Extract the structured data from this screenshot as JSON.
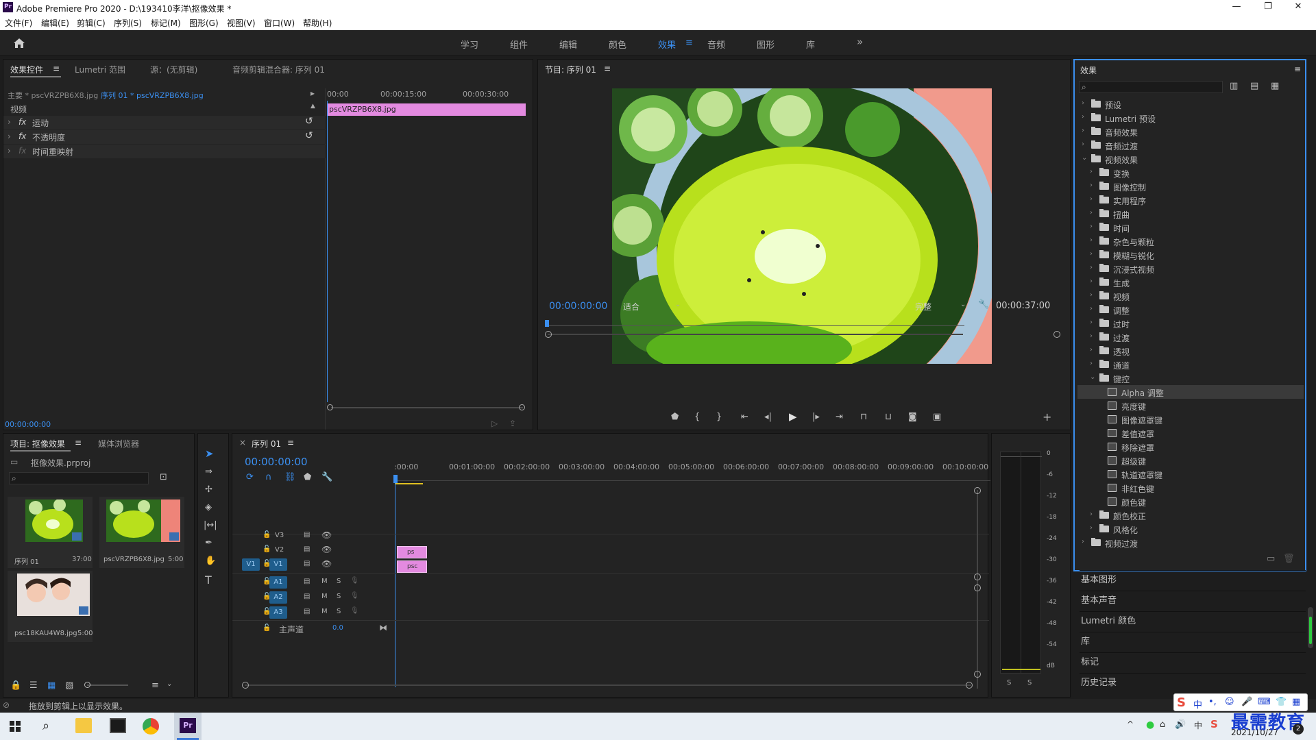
{
  "titlebar": {
    "logo": "Pr",
    "title": "Adobe Premiere Pro 2020 - D:\\193410李洋\\抠像效果 *",
    "min": "—",
    "max": "❐",
    "close": "✕"
  },
  "menu": [
    "文件(F)",
    "编辑(E)",
    "剪辑(C)",
    "序列(S)",
    "标记(M)",
    "图形(G)",
    "视图(V)",
    "窗口(W)",
    "帮助(H)"
  ],
  "workspaces": {
    "items": [
      "学习",
      "组件",
      "编辑",
      "颜色",
      "效果",
      "音频",
      "图形",
      "库"
    ],
    "active": "效果",
    "more": "»"
  },
  "effect_controls": {
    "tabs": [
      "效果控件",
      "Lumetri 范围",
      "源：(无剪辑)",
      "音频剪辑混合器: 序列 01"
    ],
    "master": "主要 * pscVRZPB6X8.jpg",
    "sequence": "序列 01 * pscVRZPB6X8.jpg",
    "section": "视频",
    "rows": [
      "运动",
      "不透明度",
      "时间重映射"
    ],
    "ruler": [
      "00:00",
      "00:00:15:00",
      "00:00:30:00"
    ],
    "clip": "pscVRZPB6X8.jpg",
    "timecode": "00:00:00:00"
  },
  "program": {
    "title": "节目: 序列 01",
    "timecode": "00:00:00:00",
    "fit": "适合",
    "quality": "完整",
    "duration": "00:00:37:00"
  },
  "effects_panel": {
    "title": "效果",
    "search_placeholder": "",
    "tree": [
      {
        "label": "预设",
        "level": 0,
        "type": "folder",
        "open": false
      },
      {
        "label": "Lumetri 预设",
        "level": 0,
        "type": "folder",
        "open": false
      },
      {
        "label": "音频效果",
        "level": 0,
        "type": "folder",
        "open": false
      },
      {
        "label": "音频过渡",
        "level": 0,
        "type": "folder",
        "open": false
      },
      {
        "label": "视频效果",
        "level": 0,
        "type": "folder",
        "open": true
      },
      {
        "label": "变换",
        "level": 1,
        "type": "folder",
        "open": false
      },
      {
        "label": "图像控制",
        "level": 1,
        "type": "folder",
        "open": false
      },
      {
        "label": "实用程序",
        "level": 1,
        "type": "folder",
        "open": false
      },
      {
        "label": "扭曲",
        "level": 1,
        "type": "folder",
        "open": false
      },
      {
        "label": "时间",
        "level": 1,
        "type": "folder",
        "open": false
      },
      {
        "label": "杂色与颗粒",
        "level": 1,
        "type": "folder",
        "open": false
      },
      {
        "label": "模糊与锐化",
        "level": 1,
        "type": "folder",
        "open": false
      },
      {
        "label": "沉浸式视频",
        "level": 1,
        "type": "folder",
        "open": false
      },
      {
        "label": "生成",
        "level": 1,
        "type": "folder",
        "open": false
      },
      {
        "label": "视频",
        "level": 1,
        "type": "folder",
        "open": false
      },
      {
        "label": "调整",
        "level": 1,
        "type": "folder",
        "open": false
      },
      {
        "label": "过时",
        "level": 1,
        "type": "folder",
        "open": false
      },
      {
        "label": "过渡",
        "level": 1,
        "type": "folder",
        "open": false
      },
      {
        "label": "透视",
        "level": 1,
        "type": "folder",
        "open": false
      },
      {
        "label": "通道",
        "level": 1,
        "type": "folder",
        "open": false
      },
      {
        "label": "键控",
        "level": 1,
        "type": "folder",
        "open": true
      },
      {
        "label": "Alpha 调整",
        "level": 2,
        "type": "preset",
        "selected": true
      },
      {
        "label": "亮度键",
        "level": 2,
        "type": "preset"
      },
      {
        "label": "图像遮罩键",
        "level": 2,
        "type": "preset"
      },
      {
        "label": "差值遮罩",
        "level": 2,
        "type": "preset"
      },
      {
        "label": "移除遮罩",
        "level": 2,
        "type": "preset"
      },
      {
        "label": "超级键",
        "level": 2,
        "type": "preset"
      },
      {
        "label": "轨道遮罩键",
        "level": 2,
        "type": "preset"
      },
      {
        "label": "非红色键",
        "level": 2,
        "type": "preset"
      },
      {
        "label": "颜色键",
        "level": 2,
        "type": "preset"
      },
      {
        "label": "颜色校正",
        "level": 1,
        "type": "folder",
        "open": false
      },
      {
        "label": "风格化",
        "level": 1,
        "type": "folder",
        "open": false
      },
      {
        "label": "视频过渡",
        "level": 0,
        "type": "folder",
        "open": false
      }
    ]
  },
  "side_panels": [
    "基本图形",
    "基本声音",
    "Lumetri 颜色",
    "库",
    "标记",
    "历史记录"
  ],
  "project": {
    "tabs": [
      "项目: 抠像效果",
      "媒体浏览器"
    ],
    "file": "抠像效果.prproj",
    "items": [
      {
        "name": "序列 01",
        "duration": "37:00"
      },
      {
        "name": "pscVRZPB6X8.jpg",
        "duration": "5:00"
      },
      {
        "name": "psc18KAU4W8.jpg",
        "duration": "5:00"
      }
    ]
  },
  "timeline": {
    "tab": "序列 01",
    "timecode": "00:00:00:00",
    "ruler": [
      ":00:00",
      "00:01:00:00",
      "00:02:00:00",
      "00:03:00:00",
      "00:04:00:00",
      "00:05:00:00",
      "00:06:00:00",
      "00:07:00:00",
      "00:08:00:00",
      "00:09:00:00",
      "00:10:00:00"
    ],
    "video_tracks": [
      "V3",
      "V2",
      "V1"
    ],
    "audio_tracks": [
      "A1",
      "A2",
      "A3"
    ],
    "source_patch": "V1",
    "master": "主声道",
    "master_value": "0.0",
    "clip_v2": "ps",
    "clip_v1": "psc",
    "m_label": "M",
    "s_label": "S"
  },
  "meter": {
    "scale": [
      "0",
      "-6",
      "-12",
      "-18",
      "-24",
      "-30",
      "-36",
      "-42",
      "-48",
      "-54",
      "dB"
    ],
    "solo": [
      "S",
      "S"
    ]
  },
  "status": "拖放到剪辑上以显示效果。",
  "taskbar": {
    "date": "2021/10/27",
    "watermark": "最需教育",
    "ime": "中",
    "badge": "2"
  },
  "colors": {
    "accent": "#3b8ff0",
    "clip": "#e38ae0",
    "track_on": "#1f5d8c"
  }
}
